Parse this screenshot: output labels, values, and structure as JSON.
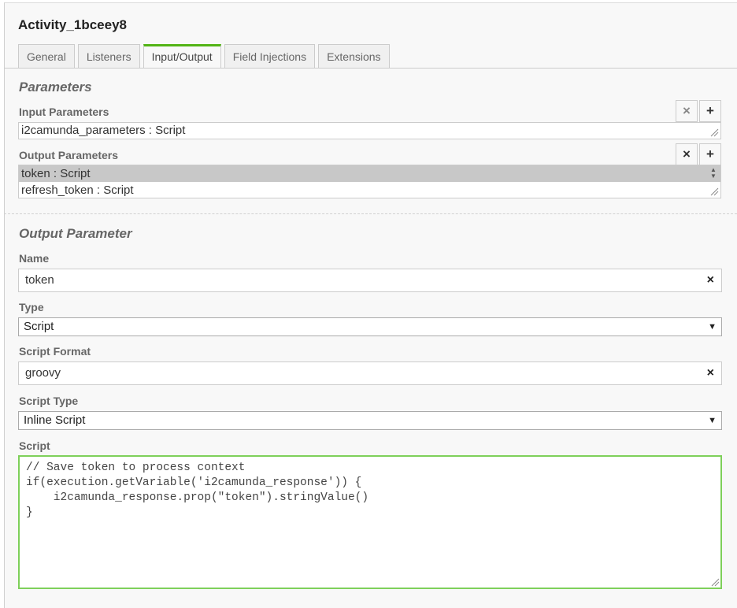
{
  "element_title": "Activity_1bceey8",
  "tabs": [
    {
      "label": "General",
      "active": false
    },
    {
      "label": "Listeners",
      "active": false
    },
    {
      "label": "Input/Output",
      "active": true
    },
    {
      "label": "Field Injections",
      "active": false
    },
    {
      "label": "Extensions",
      "active": false
    }
  ],
  "parameters": {
    "group_title": "Parameters",
    "input": {
      "label": "Input Parameters",
      "items": [
        "i2camunda_parameters : Script"
      ],
      "remove_icon": "×",
      "add_icon": "+"
    },
    "output": {
      "label": "Output Parameters",
      "items": [
        "token : Script",
        "refresh_token : Script"
      ],
      "selected_index": 0,
      "remove_icon": "×",
      "add_icon": "+"
    }
  },
  "output_parameter": {
    "group_title": "Output Parameter",
    "name": {
      "label": "Name",
      "value": "token",
      "clear_icon": "×"
    },
    "type": {
      "label": "Type",
      "value": "Script",
      "arrow": "▼"
    },
    "script_format": {
      "label": "Script Format",
      "value": "groovy",
      "clear_icon": "×"
    },
    "script_type": {
      "label": "Script Type",
      "value": "Inline Script",
      "arrow": "▼"
    },
    "script": {
      "label": "Script",
      "value": "// Save token to process context\nif(execution.getVariable('i2camunda_response')) {\n    i2camunda_response.prop(\"token\").stringValue()\n}"
    }
  },
  "colors": {
    "active_tab_accent": "#52b415",
    "focused_border": "#7ed05a",
    "selected_row": "#c8c8c8"
  }
}
